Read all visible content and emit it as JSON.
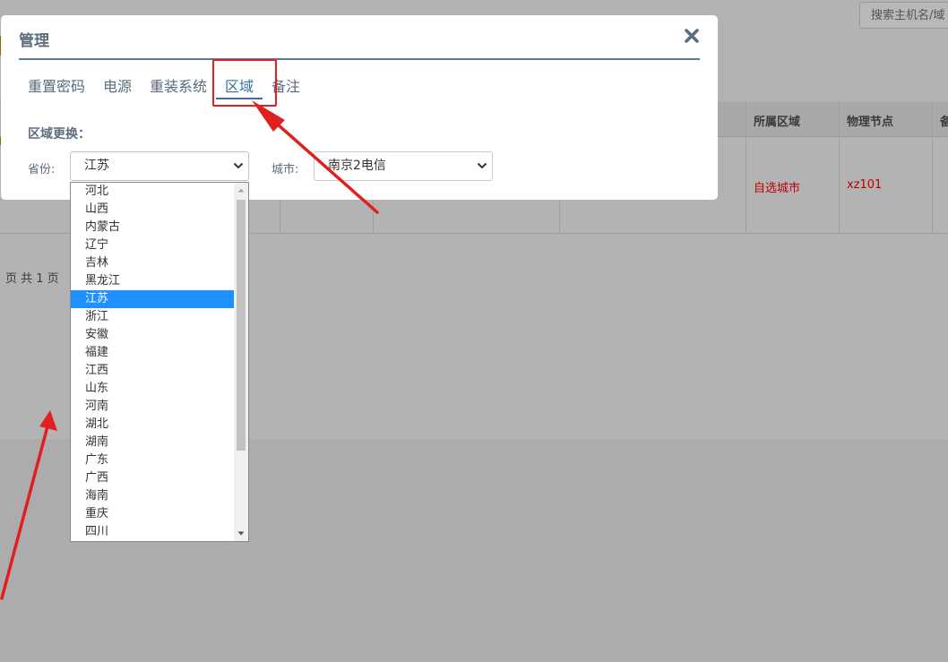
{
  "background": {
    "search_placeholder": "搜索主机名/域",
    "table_headers": [
      "所属区域",
      "物理节点",
      "备"
    ],
    "row": {
      "region": "自选城市",
      "node": "xz101"
    },
    "pager_text": "页 共 1 页"
  },
  "modal": {
    "title": "管理",
    "close_icon": "close-icon",
    "tabs": [
      {
        "label": "重置密码",
        "active": false
      },
      {
        "label": "电源",
        "active": false
      },
      {
        "label": "重装系统",
        "active": false
      },
      {
        "label": "区域",
        "active": true
      },
      {
        "label": "备注",
        "active": false
      }
    ],
    "section_label": "区域更换：",
    "province_label": "省份:",
    "province_value": "江苏",
    "city_label": "城市:",
    "city_value": "南京2电信"
  },
  "province_dropdown": {
    "options": [
      "河北",
      "山西",
      "内蒙古",
      "辽宁",
      "吉林",
      "黑龙江",
      "江苏",
      "浙江",
      "安徽",
      "福建",
      "江西",
      "山东",
      "河南",
      "湖北",
      "湖南",
      "广东",
      "广西",
      "海南",
      "重庆",
      "四川"
    ],
    "selected": "江苏"
  },
  "colors": {
    "accent": "#3a6ea5",
    "selected_option": "#1e90ff",
    "annotation": "#e02020",
    "table_highlight": "#c00000"
  }
}
